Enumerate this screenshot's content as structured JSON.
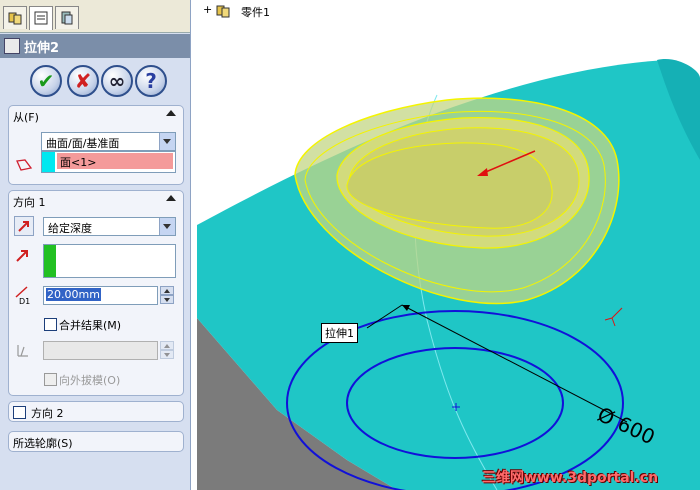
{
  "feature_manager": {
    "tabs": [
      {
        "name": "feature-tree",
        "icon": "feature-tree-icon"
      },
      {
        "name": "property-manager",
        "icon": "property-manager-icon"
      },
      {
        "name": "configuration",
        "icon": "configuration-icon"
      }
    ],
    "title": "拉伸2",
    "buttons": [
      {
        "name": "ok",
        "glyph": "✔",
        "icon": "ok-check-icon",
        "color": "#1a9a1a"
      },
      {
        "name": "cancel",
        "glyph": "✘",
        "icon": "cancel-x-icon",
        "color": "#d02020"
      },
      {
        "name": "preview",
        "glyph": "∞",
        "icon": "preview-glasses-icon",
        "color": "#223"
      },
      {
        "name": "help",
        "glyph": "?",
        "icon": "help-question-icon",
        "color": "#2a3fa0"
      }
    ],
    "from_group": {
      "label": "从(F)",
      "select_value": "曲面/面/基准面",
      "selection_item": "面<1>"
    },
    "direction1_group": {
      "label": "方向 1",
      "end_condition": "给定深度",
      "depth_value": "20.00mm",
      "merge_label": "合并结果(M)",
      "draft_label": "向外拔模(O)"
    },
    "direction2_group": {
      "label": "方向 2"
    },
    "contours_group": {
      "label": "所选轮廓(S)"
    }
  },
  "viewport": {
    "tree_root": "零件1",
    "feature_tag": "拉伸1",
    "dimension_text": "Ø 600",
    "watermark": "三维网www.3dportal.cn",
    "colors": {
      "body": "#1fc6c6",
      "body_dark": "#13a2a6",
      "preview": "#cbd77f",
      "sketch_blue": "#1111d9",
      "ground": "#7b7b7b"
    }
  }
}
